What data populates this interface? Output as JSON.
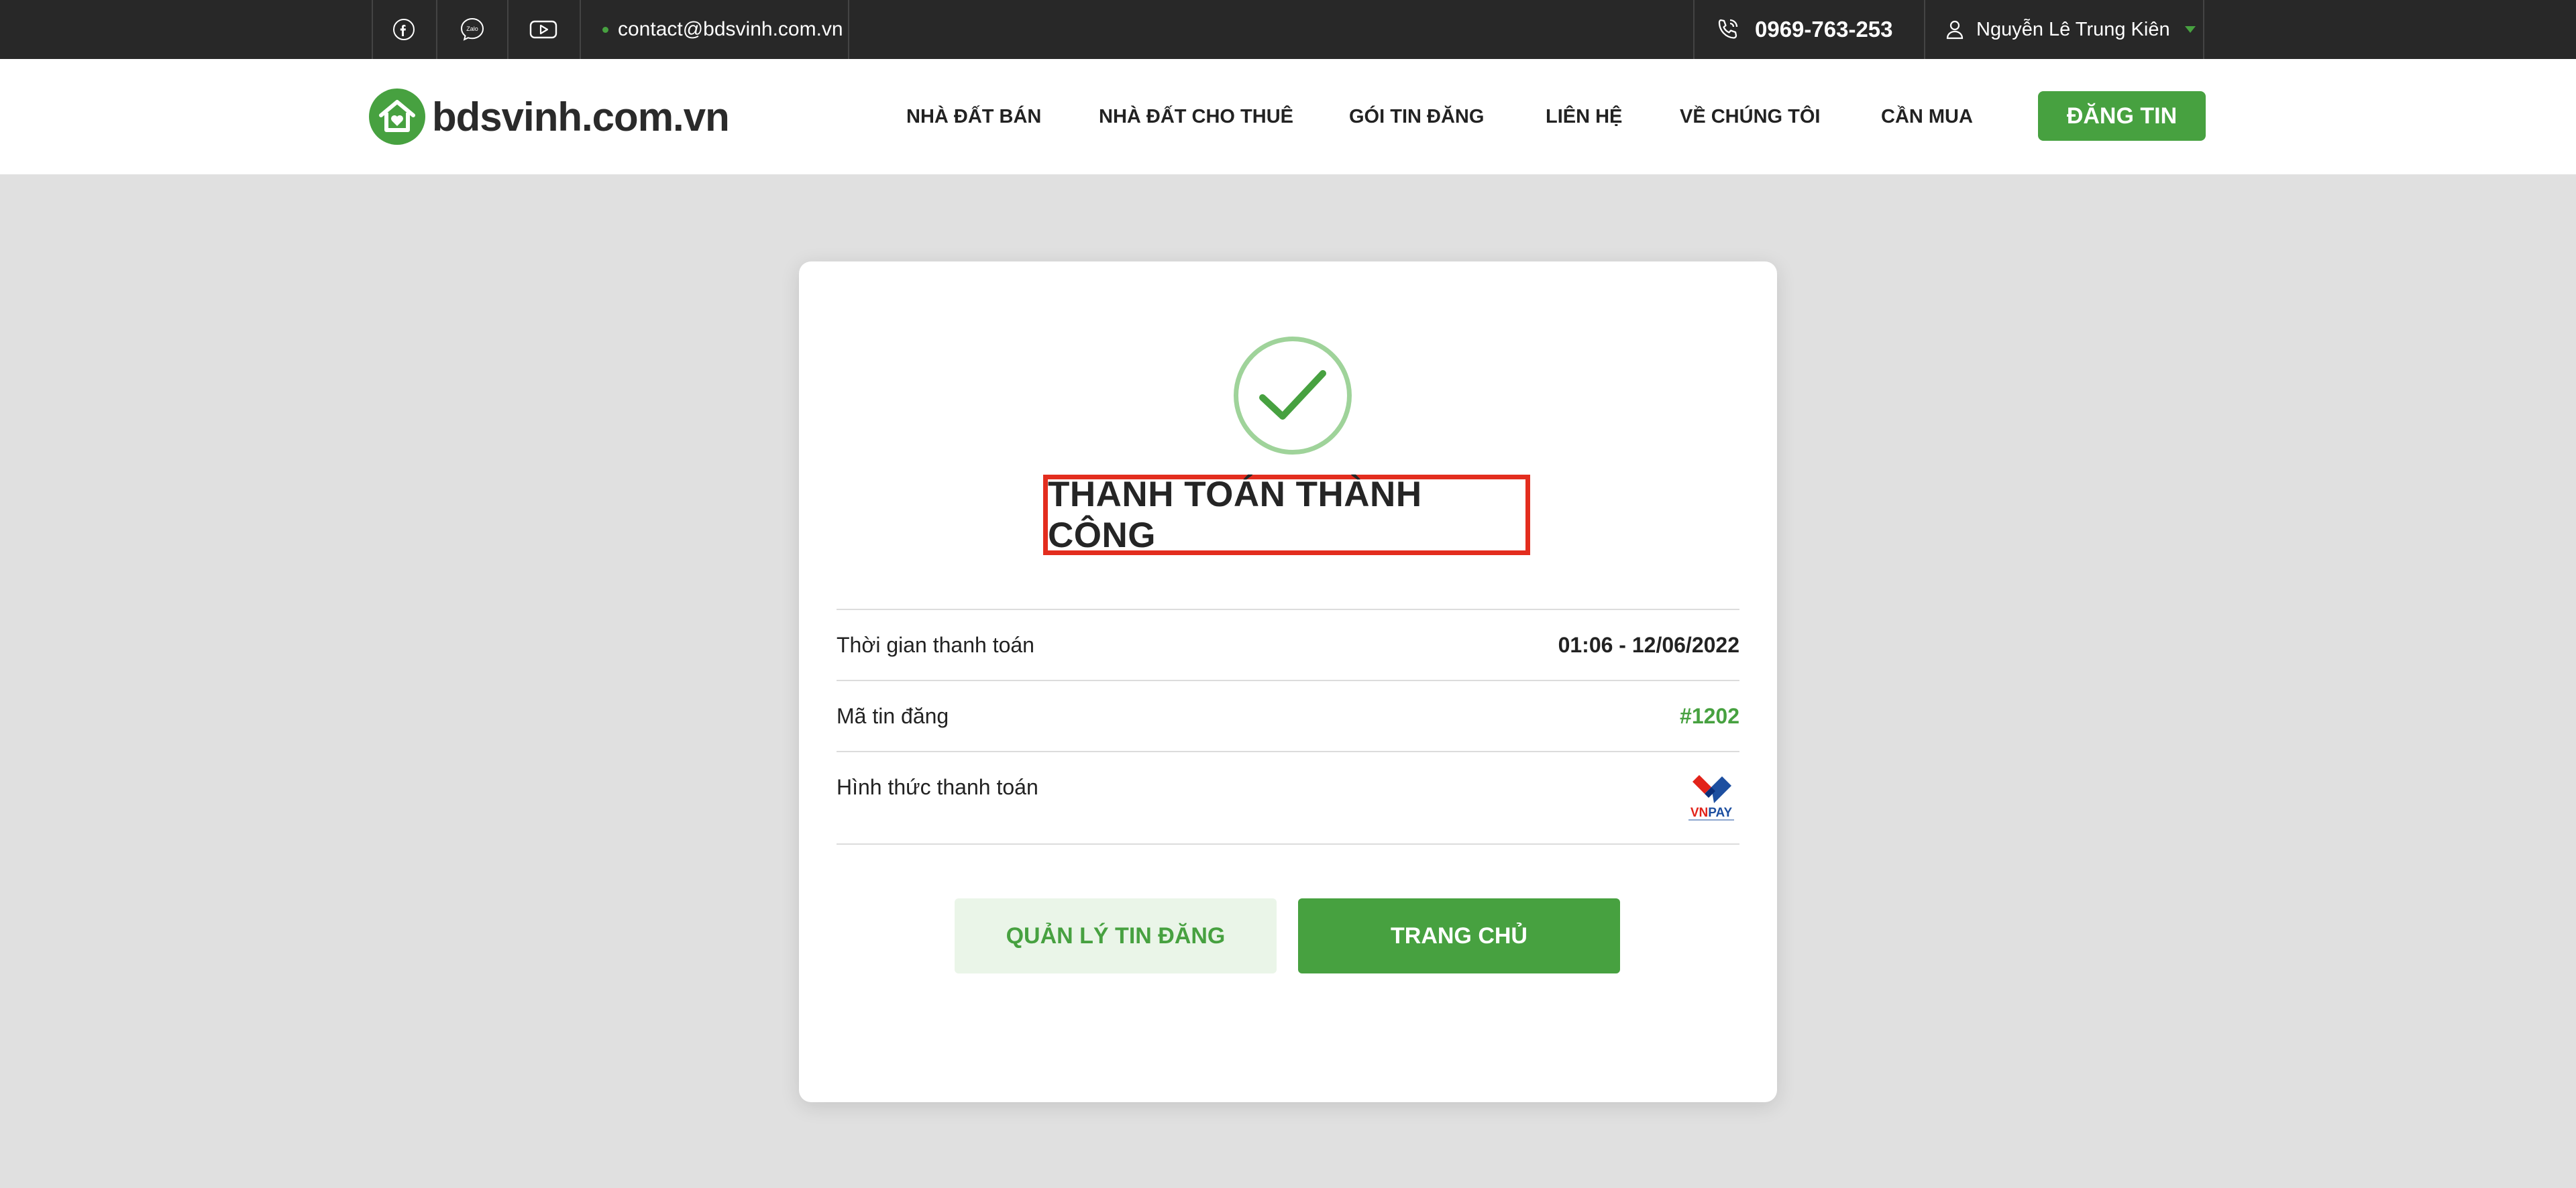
{
  "topbar": {
    "social": [
      {
        "name": "facebook-icon"
      },
      {
        "name": "zalo-icon",
        "label": "Zalo"
      },
      {
        "name": "youtube-icon"
      }
    ],
    "email": "contact@bdsvinh.com.vn",
    "phone": "0969-763-253",
    "user_name": "Nguyễn Lê Trung Kiên"
  },
  "header": {
    "logo_text": "bdsvinh.com.vn",
    "nav": [
      {
        "label": "NHÀ ĐẤT BÁN"
      },
      {
        "label": "NHÀ ĐẤT CHO THUÊ"
      },
      {
        "label": "GÓI TIN ĐĂNG"
      },
      {
        "label": "LIÊN HỆ"
      },
      {
        "label": "VỀ CHÚNG TÔI"
      },
      {
        "label": "CẦN MUA"
      }
    ],
    "post_button": "ĐĂNG TIN"
  },
  "card": {
    "title": "THANH TOÁN THÀNH CÔNG",
    "rows": [
      {
        "label": "Thời gian thanh toán",
        "value": "01:06 - 12/06/2022"
      },
      {
        "label": "Mã tin đăng",
        "value": "#1202"
      },
      {
        "label": "Hình thức thanh toán",
        "value_logo": "VNPAY"
      }
    ],
    "buttons": {
      "manage": "QUẢN LÝ TIN ĐĂNG",
      "home": "TRANG CHỦ"
    }
  },
  "colors": {
    "brand_green": "#47a140",
    "topbar_bg": "#282828",
    "page_bg": "#e0e0e0",
    "highlight_red": "#e32d1e"
  }
}
